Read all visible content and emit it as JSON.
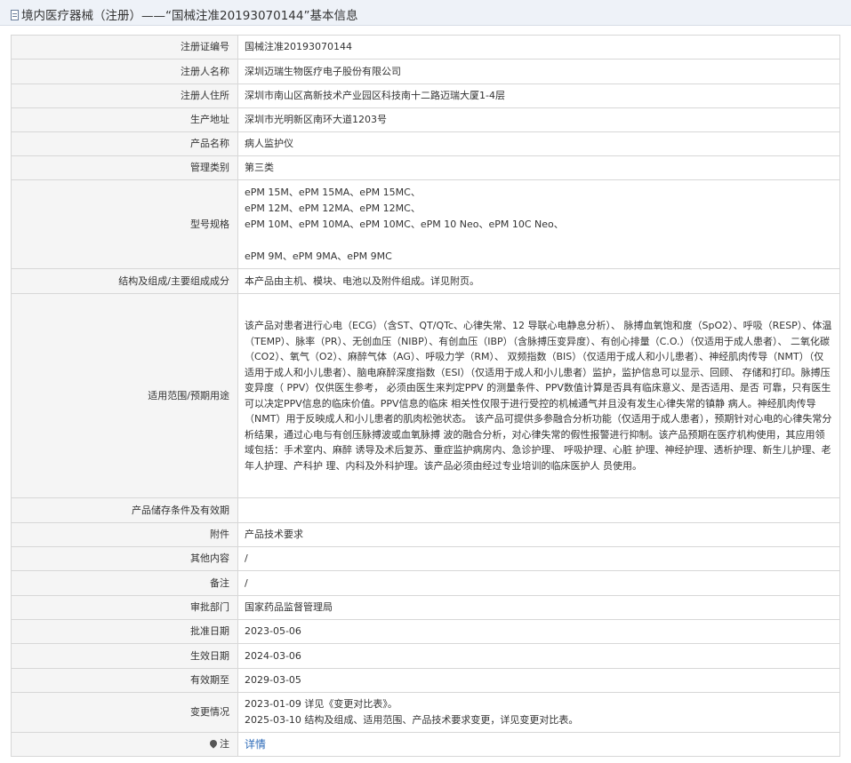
{
  "header": {
    "title": "境内医疗器械（注册）——“国械注准20193070144”基本信息"
  },
  "rows": [
    {
      "label": "注册证编号",
      "value": "国械注准20193070144"
    },
    {
      "label": "注册人名称",
      "value": "深圳迈瑞生物医疗电子股份有限公司"
    },
    {
      "label": "注册人住所",
      "value": "深圳市南山区高新技术产业园区科技南十二路迈瑞大厦1-4层"
    },
    {
      "label": "生产地址",
      "value": "深圳市光明新区南环大道1203号"
    },
    {
      "label": "产品名称",
      "value": "病人监护仪"
    },
    {
      "label": "管理类别",
      "value": "第三类"
    },
    {
      "label": "型号规格",
      "lines": [
        "ePM 15M、ePM 15MA、ePM 15MC、",
        "ePM 12M、ePM 12MA、ePM 12MC、",
        "ePM 10M、ePM 10MA、ePM 10MC、ePM 10 Neo、ePM 10C Neo、",
        "",
        "ePM 9M、ePM 9MA、ePM 9MC"
      ]
    },
    {
      "label": "结构及组成/主要组成成分",
      "value": "本产品由主机、模块、电池以及附件组成。详见附页。"
    },
    {
      "label": "适用范围/预期用途",
      "value": "该产品对患者进行心电（ECG）（含ST、QT/QTc、心律失常、12 导联心电静息分析）、 脉搏血氧饱和度（SpO2）、呼吸（RESP）、体温（TEMP）、脉率（PR）、无创血压（NIBP）、有创血压（IBP）（含脉搏压变异度）、有创心排量（C.O.）（仅适用于成人患者）、 二氧化碳（CO2）、氧气（O2）、麻醉气体（AG）、呼吸力学（RM）、 双频指数（BIS）（仅适用于成人和小儿患者）、神经肌肉传导（NMT）（仅适用于成人和小儿患者）、脑电麻醉深度指数（ESI）（仅适用于成人和小儿患者）监护，监护信息可以显示、回顾、 存储和打印。脉搏压变异度（ PPV）仅供医生参考， 必须由医生来判定PPV 的测量条件、PPV数值计算是否具有临床意义、是否适用、是否 可靠，只有医生可以决定PPV信息的临床价值。PPV信息的临床 相关性仅限于进行受控的机械通气并且没有发生心律失常的镇静 病人。神经肌肉传导（NMT）用于反映成人和小儿患者的肌肉松弛状态。 该产品可提供多参融合分析功能（仅适用于成人患者），预期针对心电的心律失常分析结果，通过心电与有创压脉搏波或血氧脉搏 波的融合分析，对心律失常的假性报警进行抑制。该产品预期在医疗机构使用，其应用领域包括：手术室内、麻醉 诱导及术后复苏、重症监护病房内、急诊护理、 呼吸护理、心脏 护理、神经护理、透析护理、新生儿护理、老年人护理、产科护 理、内科及外科护理。该产品必须由经过专业培训的临床医护人 员使用。"
    },
    {
      "label": "产品储存条件及有效期",
      "value": ""
    },
    {
      "label": "附件",
      "value": "产品技术要求"
    },
    {
      "label": "其他内容",
      "value": "/"
    },
    {
      "label": "备注",
      "value": "/"
    },
    {
      "label": "审批部门",
      "value": "国家药品监督管理局"
    },
    {
      "label": "批准日期",
      "value": "2023-05-06"
    },
    {
      "label": "生效日期",
      "value": "2024-03-06"
    },
    {
      "label": "有效期至",
      "value": "2029-03-05"
    },
    {
      "label": "变更情况",
      "lines": [
        "2023-01-09 详见《变更对比表》。",
        "2025-03-10 结构及组成、适用范围、产品技术要求变更，详见变更对比表。"
      ]
    },
    {
      "label": "注",
      "value": "详情"
    }
  ],
  "icons": {
    "title": "document-icon",
    "note": "map-pin-icon"
  },
  "colors": {
    "header_bg": "#eef2f8",
    "label_bg": "#f5f5f5",
    "border": "#d7d7d7",
    "link": "#2e6bb8"
  }
}
